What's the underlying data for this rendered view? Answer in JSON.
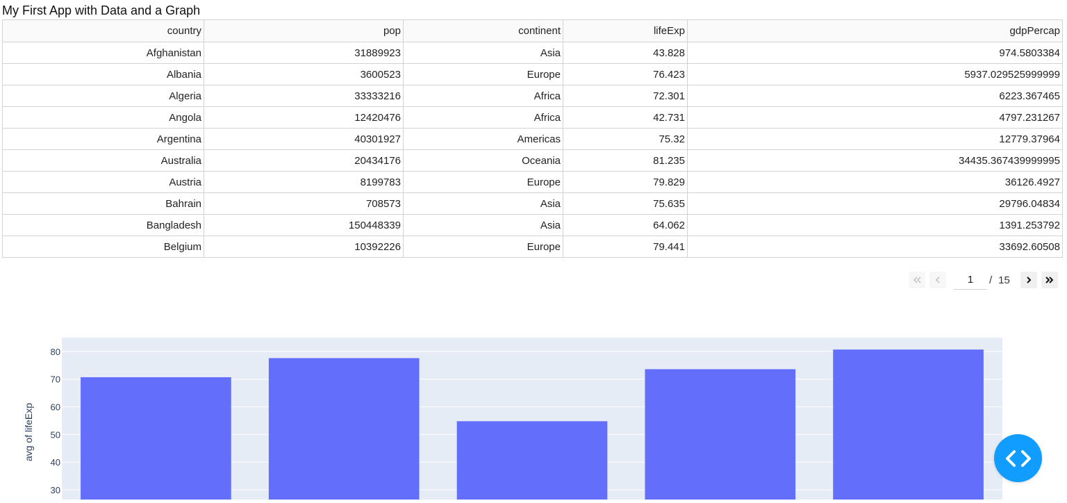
{
  "app": {
    "title": "My First App with Data and a Graph"
  },
  "table": {
    "columns": [
      "country",
      "pop",
      "continent",
      "lifeExp",
      "gdpPercap"
    ],
    "rows": [
      [
        "Afghanistan",
        "31889923",
        "Asia",
        "43.828",
        "974.5803384"
      ],
      [
        "Albania",
        "3600523",
        "Europe",
        "76.423",
        "5937.029525999999"
      ],
      [
        "Algeria",
        "33333216",
        "Africa",
        "72.301",
        "6223.367465"
      ],
      [
        "Angola",
        "12420476",
        "Africa",
        "42.731",
        "4797.231267"
      ],
      [
        "Argentina",
        "40301927",
        "Americas",
        "75.32",
        "12779.37964"
      ],
      [
        "Australia",
        "20434176",
        "Oceania",
        "81.235",
        "34435.367439999995"
      ],
      [
        "Austria",
        "8199783",
        "Europe",
        "79.829",
        "36126.4927"
      ],
      [
        "Bahrain",
        "708573",
        "Asia",
        "75.635",
        "29796.04834"
      ],
      [
        "Bangladesh",
        "150448339",
        "Asia",
        "64.062",
        "1391.253792"
      ],
      [
        "Belgium",
        "10392226",
        "Europe",
        "79.441",
        "33692.60508"
      ]
    ]
  },
  "pagination": {
    "current": "1",
    "separator": "/",
    "total": "15",
    "first_icon": "double-chevron-left-icon",
    "prev_icon": "chevron-left-icon",
    "next_icon": "chevron-right-icon",
    "last_icon": "double-chevron-right-icon"
  },
  "chart_data": {
    "type": "bar",
    "ylabel": "avg of lifeExp",
    "xlabel": "",
    "values": [
      70.7,
      77.6,
      54.8,
      73.6,
      80.7
    ],
    "ylim": [
      26.5,
      85
    ],
    "yticks": [
      30,
      40,
      50,
      60,
      70,
      80
    ],
    "grid": true,
    "bar_color": "#636efa",
    "plot_bg": "#e5ecf6"
  },
  "fab": {
    "icon": "code-brackets-icon"
  }
}
